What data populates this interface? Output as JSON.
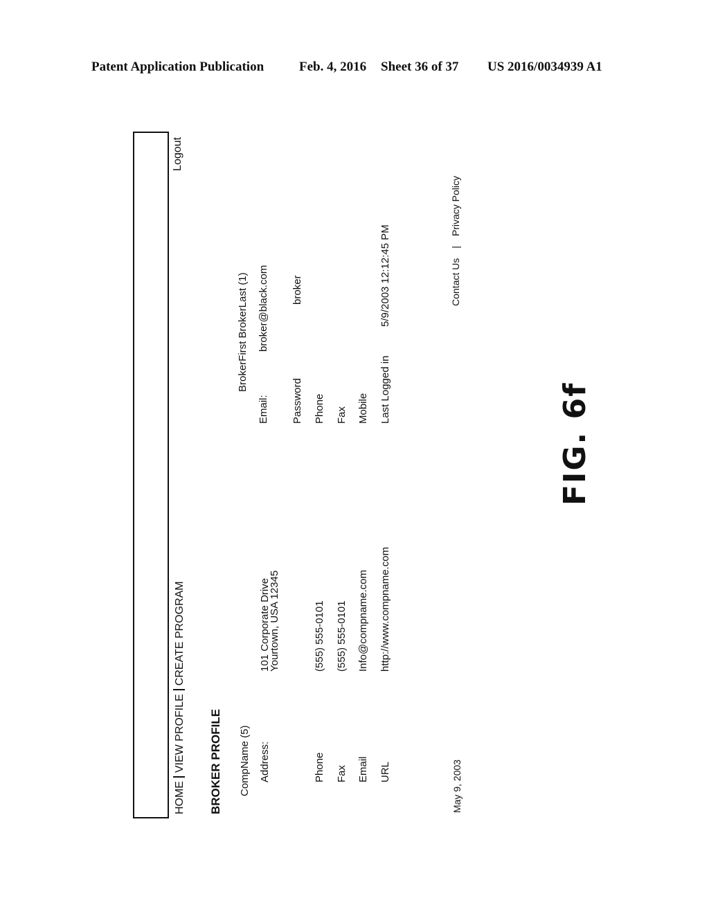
{
  "patent_header": {
    "publication": "Patent Application Publication",
    "date": "Feb. 4, 2016",
    "sheet": "Sheet 36 of 37",
    "number": "US 2016/0034939 A1"
  },
  "nav": {
    "items": [
      "HOME",
      "VIEW PROFILE",
      "CREATE PROGRAM"
    ],
    "logout": "Logout"
  },
  "page_title": "BROKER PROFILE",
  "company": {
    "name": "CompName (5)",
    "address_label": "Address:",
    "address_line1": "101 Corporate Drive",
    "address_line2": "Yourtown, USA  12345",
    "phone_label": "Phone",
    "phone": "(555) 555-0101",
    "fax_label": "Fax",
    "fax": "(555) 555-0101",
    "email_label": "Email",
    "email": "Info@compname.com",
    "url_label": "URL",
    "url": "http://www.compname.com"
  },
  "broker": {
    "name": "BrokerFirst BrokerLast (1)",
    "email_label": "Email:",
    "email": "broker@black.com",
    "password_label": "Password",
    "password": "broker",
    "phone_label": "Phone",
    "fax_label": "Fax",
    "mobile_label": "Mobile",
    "last_logged_label": "Last Logged in",
    "last_logged": "5/9/2003 12:12:45 PM"
  },
  "footer": {
    "date": "May 9, 2003",
    "contact": "Contact Us",
    "separator": "|",
    "privacy": "Privacy Policy"
  },
  "figure_label": "FIG. 6f"
}
